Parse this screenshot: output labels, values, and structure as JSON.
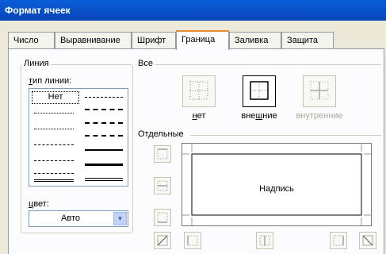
{
  "window": {
    "title": "Формат ячеек"
  },
  "tabs": [
    {
      "label": "Число"
    },
    {
      "label": "Выравнивание"
    },
    {
      "label": "Шрифт"
    },
    {
      "label": "Граница"
    },
    {
      "label": "Заливка"
    },
    {
      "label": "Защита"
    }
  ],
  "line_group": {
    "title": "Линия",
    "type_label_u": "т",
    "type_label_rest": "ип линии:",
    "none_option": "Нет",
    "color_label_u": "ц",
    "color_label_rest": "вет:",
    "color_value": "Авто"
  },
  "presets": {
    "title": "Все",
    "none_u": "н",
    "none_rest": "ет",
    "outline_pre": "вне",
    "outline_u": "ш",
    "outline_post": "ние",
    "inside": "внутренние"
  },
  "separate": {
    "title": "Отдельные",
    "preview_text": "Надпись"
  },
  "colors": {
    "title_bar": "#0843b8",
    "active_tab_accent": "#e68b2c"
  }
}
